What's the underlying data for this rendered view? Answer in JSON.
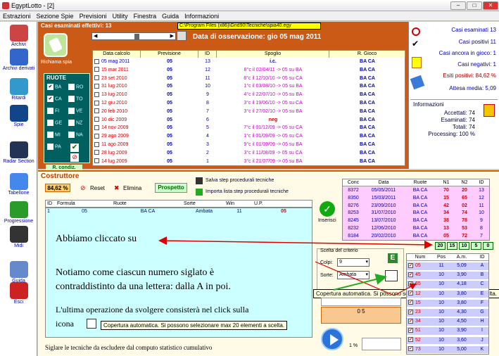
{
  "window": {
    "title": "EgyptLotto - [2]"
  },
  "menu": [
    "Estrazioni",
    "Sezione Spie",
    "Previsioni",
    "Utility",
    "Finestra",
    "Guida",
    "Informazioni"
  ],
  "sidebar": [
    {
      "label": "Archivi",
      "color": "#c44"
    },
    {
      "label": "Archivi derivati",
      "color": "#36c"
    },
    {
      "label": "Ritardi",
      "color": "#3399cc"
    },
    {
      "label": "Spie",
      "color": "#114488"
    },
    {
      "label": "Radar Section",
      "color": "#223355"
    },
    {
      "label": "Tabellone",
      "color": "#4488ee"
    },
    {
      "label": "Progressione",
      "color": "#2a9a2a"
    },
    {
      "label": "Midi",
      "color": "#333"
    },
    {
      "label": "Guida",
      "color": "#6688cc"
    },
    {
      "label": "Esci",
      "color": "#cc2222"
    }
  ],
  "top": {
    "casi_label": "Casi esaminati effettivi: 13",
    "path": "C:\\Program Files (x86)\\Grid90\\Tecniche\\spia40.egy",
    "osservazione": "Data di osservazione:  gio 05 mag 2011",
    "richiama": "Richiama spia",
    "ruote_title": "RUOTE",
    "ruote": [
      {
        "name": "BA",
        "checked": true
      },
      {
        "name": "RO",
        "checked": false
      },
      {
        "name": "CA",
        "checked": true
      },
      {
        "name": "TO",
        "checked": false
      },
      {
        "name": "FI",
        "checked": false
      },
      {
        "name": "VE",
        "checked": false
      },
      {
        "name": "GE",
        "checked": false
      },
      {
        "name": "NZ",
        "checked": false
      },
      {
        "name": "MI",
        "checked": false
      },
      {
        "name": "NA",
        "checked": false
      },
      {
        "name": "PA",
        "checked": false
      }
    ],
    "r_condiz": "R. condiz.",
    "headers": [
      "Data calcolo",
      "Previsione",
      "ID",
      "Spoglio",
      "R. Gioco"
    ],
    "rows": [
      {
        "date": "05 mag 2011",
        "prev": "05",
        "id": "13",
        "spoglio": "i.c.",
        "rg": "BA CA",
        "blue": true
      },
      {
        "date": "15 mar 2011",
        "prev": "05",
        "id": "12",
        "spoglio": "8°c il 02/04/11 -> 05 su BA",
        "rg": "BA CA"
      },
      {
        "date": "23 set 2010",
        "prev": "05",
        "id": "11",
        "spoglio": "8°c il 12/10/10 -> 05 su CA",
        "rg": "BA CA"
      },
      {
        "date": "31 lug 2010",
        "prev": "05",
        "id": "10",
        "spoglio": "1°c il 03/08/10 -> 05 su BA",
        "rg": "BA CA"
      },
      {
        "date": "13 lug 2010",
        "prev": "05",
        "id": "9",
        "spoglio": "4°c il 22/07/10 -> 05 su BA",
        "rg": "BA CA"
      },
      {
        "date": "12 giu 2010",
        "prev": "05",
        "id": "8",
        "spoglio": "3°c il 19/06/10 -> 05 su CA",
        "rg": "BA CA"
      },
      {
        "date": "20 feb 2010",
        "prev": "05",
        "id": "7",
        "spoglio": "3°c il 27/02/10 -> 05 su BA",
        "rg": "BA CA"
      },
      {
        "date": "10 dic 2009",
        "prev": "05",
        "id": "6",
        "spoglio": "neg",
        "rg": "BA CA"
      },
      {
        "date": "14 nov 2009",
        "prev": "05",
        "id": "5",
        "spoglio": "7°c il 01/12/09 -> 05 su CA",
        "rg": "BA CA"
      },
      {
        "date": "29 ago 2009",
        "prev": "05",
        "id": "4",
        "spoglio": "1°c il 01/09/09 -> 05 su CA",
        "rg": "BA CA"
      },
      {
        "date": "11 ago 2009",
        "prev": "05",
        "id": "3",
        "spoglio": "9°c il 01/09/09 -> 05 su BA",
        "rg": "BA CA"
      },
      {
        "date": "28 lug 2009",
        "prev": "05",
        "id": "2",
        "spoglio": "3°c il 11/08/09 -> 05 su CA",
        "rg": "BA CA"
      },
      {
        "date": "14 lug 2009",
        "prev": "05",
        "id": "1",
        "spoglio": "3°c il 21/07/09 -> 05 su BA",
        "rg": "BA CA"
      }
    ]
  },
  "stats": {
    "esaminati": "Casi esaminati 13",
    "positivi": "Casi positivi 11",
    "ancora": "Casi ancora in gioco: 1",
    "negativi": "Casi negativi: 1",
    "esiti": "Esiti positivi: 84,62 %",
    "attesa": "Attesa media: 5,09",
    "info_title": "Informazioni",
    "info": [
      "Accettati:  74",
      "Esaminati:  74",
      "Totali:  74",
      "Processing:  100 %"
    ]
  },
  "bottom": {
    "costruttore": "Costruttore",
    "percent": "84,62 %",
    "reset": "Reset",
    "elimina": "Elimina",
    "prospetto": "Prospetto",
    "salva": "Salva step procedurali tecniche",
    "importa": "Importa lista step procedurali tecniche",
    "inserisci": "Inserisci",
    "headers": [
      "ID",
      "Formula",
      "Ruote",
      "Sorte",
      "Win",
      "U.P."
    ],
    "row": {
      "id": "1",
      "formula": "05",
      "ruote": "BA CA",
      "sorte": "Ambata",
      "win": "11",
      "up": "05"
    },
    "text1": "Abbiamo cliccato su",
    "text2": "Notiamo come ciascun numero siglato è",
    "text3": "contraddistinto da una lettera: dalla A in poi.",
    "text4": "L'ultima operazione da svolgere consisterà nel click sulla",
    "text5": "icona",
    "tooltip": "Copertura automatica. Si possono selezionare max 20 elementi a scelta.",
    "sigla": "Siglare le tecniche da escludere dal computo statistico cumulativo",
    "scelta": "Scelta del criterio",
    "colpi_label": "Colpi:",
    "colpi": "9",
    "sorte_label": "Sorte:",
    "sorte": "Ambata",
    "e_btn": "E",
    "result": "0 5",
    "pct": "1 %",
    "conc_headers": [
      "Conc",
      "Data",
      "Ruote",
      "N1",
      "N2",
      "ID"
    ],
    "conc_rows": [
      [
        "8372",
        "05/05/2011",
        "BA CA",
        "70",
        "20",
        "13"
      ],
      [
        "8350",
        "15/03/2011",
        "BA CA",
        "15",
        "65",
        "12"
      ],
      [
        "8276",
        "23/09/2010",
        "BA CA",
        "42",
        "02",
        "11"
      ],
      [
        "8253",
        "31/07/2010",
        "BA CA",
        "34",
        "74",
        "10"
      ],
      [
        "8245",
        "13/07/2010",
        "BA CA",
        "38",
        "78",
        "9"
      ],
      [
        "8232",
        "12/06/2010",
        "BA CA",
        "13",
        "53",
        "8"
      ],
      [
        "8184",
        "20/02/2010",
        "BA CA",
        "05",
        "72",
        "7"
      ]
    ],
    "counts": [
      "20",
      "15",
      "10",
      "5",
      "0"
    ],
    "num_headers": [
      "Num",
      "Pos",
      "A.m.",
      "ID"
    ],
    "num_rows": [
      [
        "05",
        "11",
        "5,09",
        "A"
      ],
      [
        "45",
        "10",
        "3,90",
        "B"
      ],
      [
        "65",
        "10",
        "4,18",
        "C"
      ],
      [
        "12",
        "10",
        "3,80",
        "E"
      ],
      [
        "15",
        "10",
        "3,80",
        "F"
      ],
      [
        "23",
        "10",
        "4,30",
        "G"
      ],
      [
        "34",
        "10",
        "4,50",
        "H"
      ],
      [
        "51",
        "10",
        "3,90",
        "I"
      ],
      [
        "52",
        "10",
        "3,60",
        "J"
      ],
      [
        "73",
        "10",
        "5,00",
        "K"
      ]
    ]
  }
}
